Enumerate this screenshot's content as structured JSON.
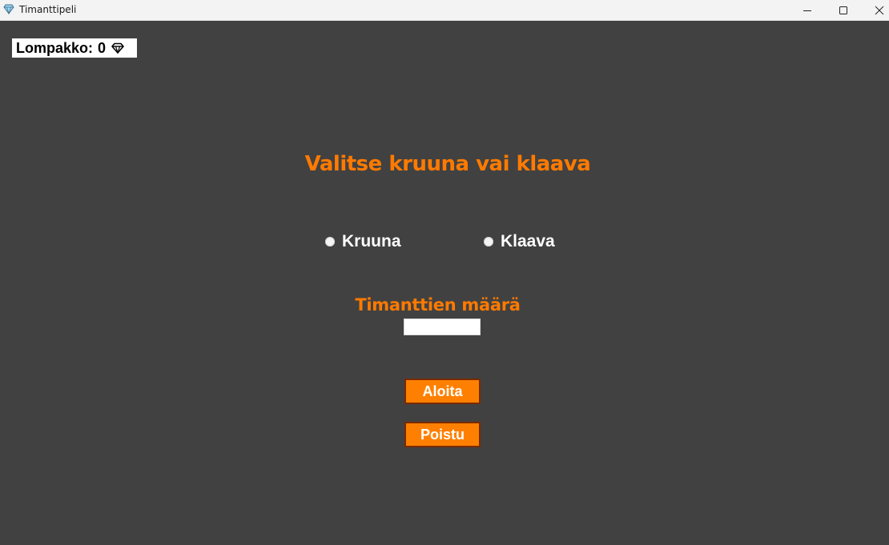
{
  "window": {
    "title": "Timanttipeli",
    "icon": "diamond-icon"
  },
  "wallet": {
    "label": "Lompakko:",
    "value": "0",
    "icon": "diamond-icon"
  },
  "main": {
    "heading": "Valitse kruuna vai klaava",
    "options": [
      {
        "label": "Kruuna",
        "selected": false
      },
      {
        "label": "Klaava",
        "selected": false
      }
    ],
    "amount_label": "Timanttien määrä",
    "amount_value": "",
    "start_label": "Aloita",
    "quit_label": "Poistu"
  },
  "colors": {
    "background": "#414141",
    "accent": "#ff7a00",
    "button": "#ff8000",
    "button_border": "#7a2a00"
  }
}
